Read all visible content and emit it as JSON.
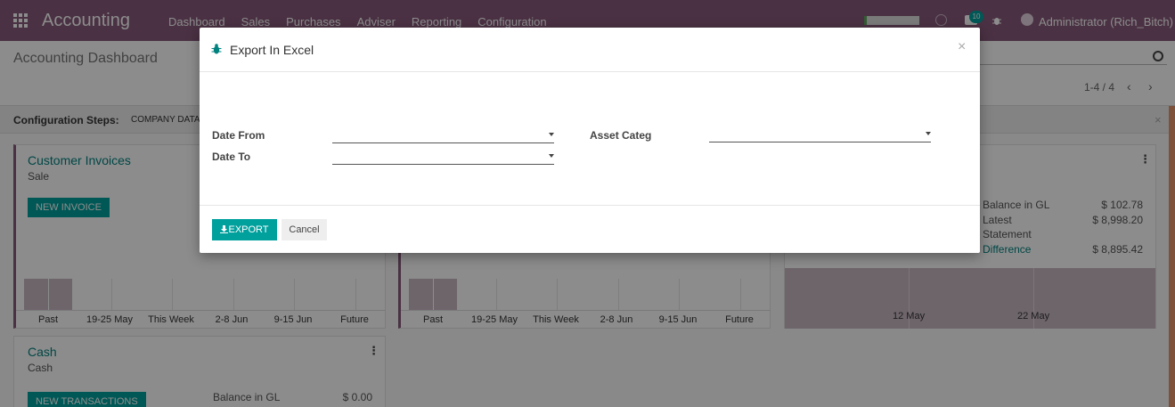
{
  "navbar": {
    "brand": "Accounting",
    "menu": [
      "Dashboard",
      "Sales",
      "Purchases",
      "Adviser",
      "Reporting",
      "Configuration"
    ],
    "chat_count": "10",
    "user": "Administrator (Rich_Bitch)"
  },
  "control_panel": {
    "title": "Accounting Dashboard",
    "pager": "1-4 / 4",
    "prev": "‹",
    "next": "›"
  },
  "config_steps": {
    "label": "Configuration Steps:",
    "item": "COMPANY DATA",
    "close": "×"
  },
  "cards": {
    "customer_invoices": {
      "title": "Customer Invoices",
      "subtitle": "Sale",
      "button": "NEW INVOICE",
      "x_labels": [
        "Past",
        "19-25 May",
        "This Week",
        "2-8 Jun",
        "9-15 Jun",
        "Future"
      ]
    },
    "vendor_bills": {
      "x_labels": [
        "Past",
        "19-25 May",
        "This Week",
        "2-8 Jun",
        "9-15 Jun",
        "Future"
      ]
    },
    "bank": {
      "x_labels": [
        "12 May",
        "22 May"
      ],
      "balance_label": "Balance in GL",
      "balance_value": "$ 102.78",
      "latest_label": "Latest",
      "latest_label2": "Statement",
      "latest_value": "$ 8,998.20",
      "difference_label": "Difference",
      "difference_value": "$ 8,895.42"
    },
    "cash": {
      "title": "Cash",
      "subtitle": "Cash",
      "button": "NEW TRANSACTIONS",
      "balance_label": "Balance in GL",
      "balance_value": "$ 0.00"
    }
  },
  "modal": {
    "title": "Export In Excel",
    "close": "×",
    "date_from_label": "Date From",
    "date_to_label": "Date To",
    "asset_categ_label": "Asset Categ",
    "export_label": "EXPORT",
    "cancel_label": "Cancel"
  }
}
